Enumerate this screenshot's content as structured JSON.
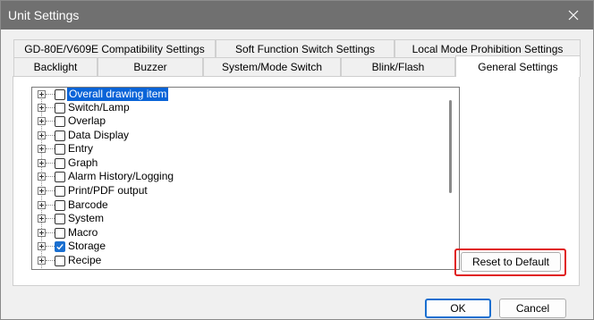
{
  "window": {
    "title": "Unit Settings",
    "close_icon": "close-icon"
  },
  "tabs_row1": [
    {
      "label": "GD-80E/V609E Compatibility Settings"
    },
    {
      "label": "Soft Function Switch Settings"
    },
    {
      "label": "Local Mode Prohibition Settings"
    }
  ],
  "tabs_row2": [
    {
      "label": "Backlight"
    },
    {
      "label": "Buzzer"
    },
    {
      "label": "System/Mode Switch"
    },
    {
      "label": "Blink/Flash"
    },
    {
      "label": "General Settings",
      "active": true
    }
  ],
  "tree": {
    "items": [
      {
        "label": "Overall drawing item",
        "checked": false,
        "selected": true
      },
      {
        "label": "Switch/Lamp",
        "checked": false
      },
      {
        "label": "Overlap",
        "checked": false
      },
      {
        "label": "Data Display",
        "checked": false
      },
      {
        "label": "Entry",
        "checked": false
      },
      {
        "label": "Graph",
        "checked": false
      },
      {
        "label": "Alarm History/Logging",
        "checked": false
      },
      {
        "label": "Print/PDF output",
        "checked": false
      },
      {
        "label": "Barcode",
        "checked": false
      },
      {
        "label": "System",
        "checked": false
      },
      {
        "label": "Macro",
        "checked": false
      },
      {
        "label": "Storage",
        "checked": true
      },
      {
        "label": "Recipe",
        "checked": false
      }
    ]
  },
  "buttons": {
    "reset_label": "Reset to Default",
    "ok_label": "OK",
    "cancel_label": "Cancel"
  },
  "colors": {
    "titlebar": "#707070",
    "selection": "#0a64d8",
    "checked": "#1a6fd0",
    "highlight": "#e01b1b"
  }
}
